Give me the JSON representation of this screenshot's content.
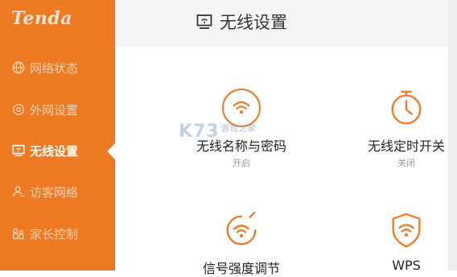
{
  "brand": "Tenda",
  "nav": [
    {
      "label": "网络状态",
      "icon": "globe-icon"
    },
    {
      "label": "外网设置",
      "icon": "wan-icon"
    },
    {
      "label": "无线设置",
      "icon": "wifi-screen-icon",
      "active": true
    },
    {
      "label": "访客网络",
      "icon": "guest-icon"
    },
    {
      "label": "家长控制",
      "icon": "parental-icon"
    }
  ],
  "header": {
    "title": "无线设置",
    "icon": "wifi-screen-icon"
  },
  "tiles": [
    {
      "label": "无线名称与密码",
      "status": "开启",
      "icon": "wifi-icon"
    },
    {
      "label": "无线定时开关",
      "status": "关闭",
      "icon": "timer-icon"
    },
    {
      "label": "信号强度调节",
      "status": "",
      "icon": "signal-strength-icon"
    },
    {
      "label": "WPS",
      "status": "",
      "icon": "wps-shield-icon"
    }
  ],
  "watermark": {
    "text": "K73",
    "sub": "游戏之家"
  },
  "colors": {
    "accent": "#ed7a23",
    "sidebar": "#ed7a23",
    "header_bg": "#f5f5f5"
  }
}
